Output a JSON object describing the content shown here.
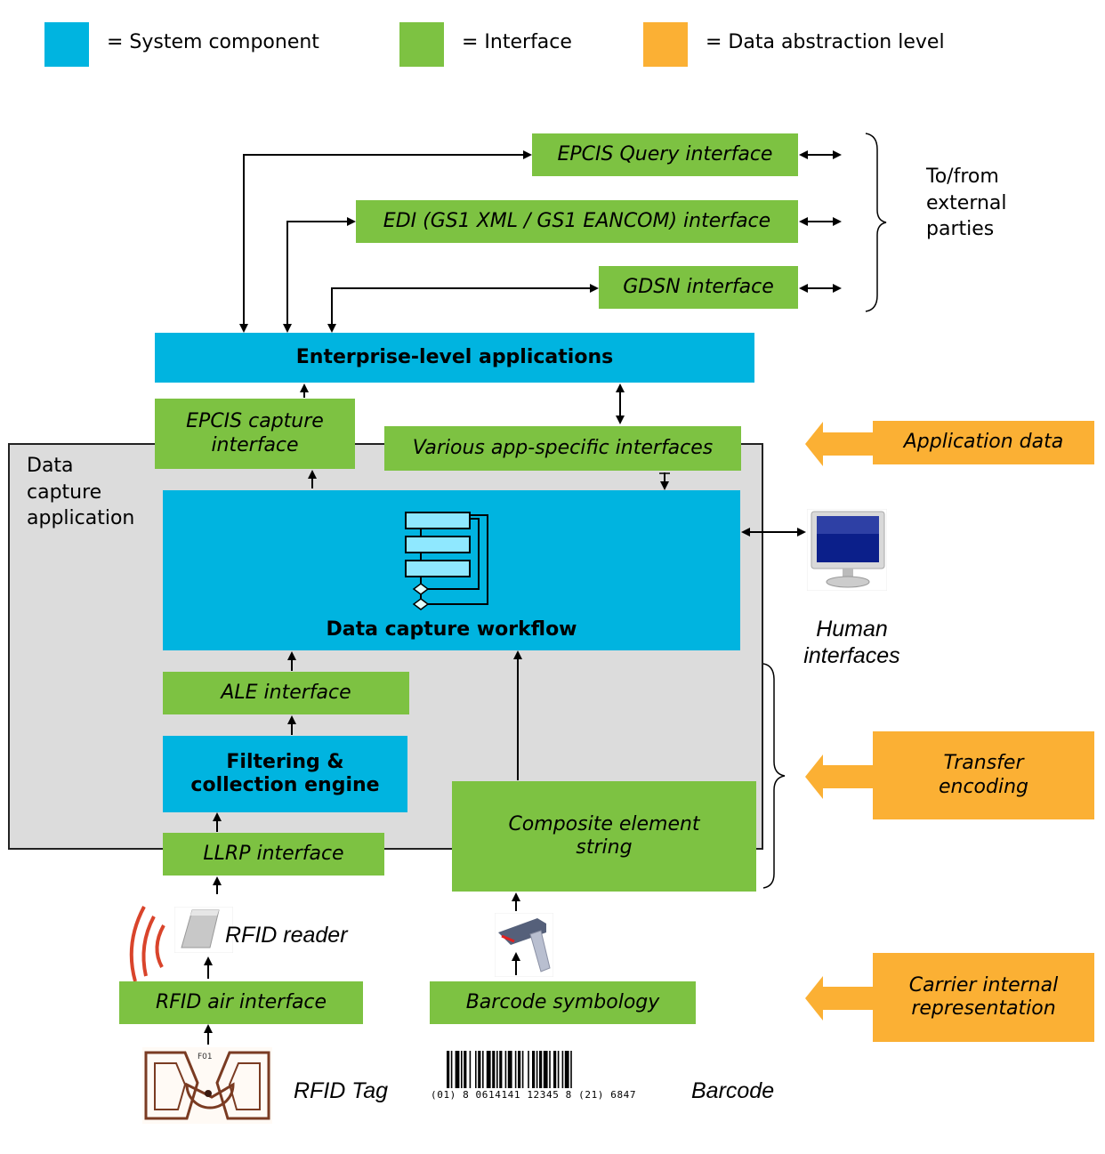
{
  "legend": [
    {
      "label": "= System component",
      "color": "#00b4e0"
    },
    {
      "label": "= Interface",
      "color": "#7dc242"
    },
    {
      "label": "= Data abstraction level",
      "color": "#fbb034"
    }
  ],
  "external": {
    "interfaces": [
      "EPCIS Query interface",
      "EDI (GS1 XML / GS1 EANCOM) interface",
      "GDSN interface"
    ],
    "label": "To/from external parties"
  },
  "enterprise": "Enterprise-level applications",
  "data_capture_app_label": "Data capture application",
  "epcis_capture": "EPCIS capture interface",
  "various_app": "Various app-specific interfaces",
  "workflow": {
    "label": "Data capture workflow",
    "icon": "workflow-flowchart-icon"
  },
  "human": {
    "label": "Human interfaces",
    "icon": "computer-monitor-icon"
  },
  "ale": "ALE interface",
  "filtering": "Filtering & collection engine",
  "llrp": "LLRP interface",
  "composite": "Composite element string",
  "rfid_reader": {
    "label": "RFID reader",
    "icon": "rfid-reader-icon"
  },
  "scanner": {
    "icon": "barcode-scanner-icon"
  },
  "rfid_air": "RFID air interface",
  "barcode_symbology": "Barcode symbology",
  "rfid_tag": {
    "label": "RFID Tag",
    "chip_text": "F01",
    "icon": "rfid-tag-icon"
  },
  "barcode": {
    "label": "Barcode",
    "digits": "(01) 8 0614141 12345 8 (21) 6847",
    "icon": "barcode-icon"
  },
  "levels": [
    "Application data",
    "Transfer encoding",
    "Carrier internal representation"
  ]
}
